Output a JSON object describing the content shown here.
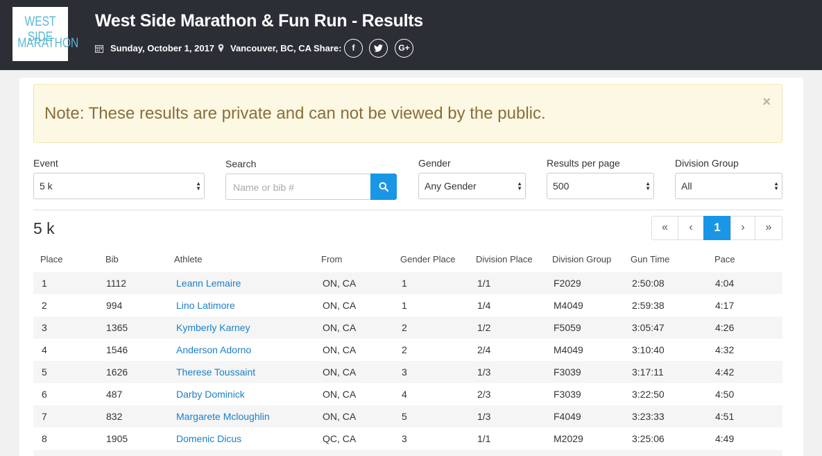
{
  "header": {
    "logo_line1": "WEST SIDE",
    "logo_line2": "MARATHON",
    "title": "West Side Marathon & Fun Run - Results",
    "date": "Sunday, October 1, 2017",
    "location": "Vancouver, BC, CA",
    "share_label": "Share:",
    "share_buttons": [
      {
        "icon": "facebook-icon",
        "glyph": "f"
      },
      {
        "icon": "twitter-icon",
        "glyph": "t"
      },
      {
        "icon": "google-plus-icon",
        "glyph": "G+"
      }
    ]
  },
  "alert": {
    "text": "Note: These results are private and can not be viewed by the public.",
    "close": "×"
  },
  "filters": {
    "event": {
      "label": "Event",
      "value": "5 k"
    },
    "search": {
      "label": "Search",
      "placeholder": "Name or bib #"
    },
    "gender": {
      "label": "Gender",
      "value": "Any Gender"
    },
    "per_page": {
      "label": "Results per page",
      "value": "500"
    },
    "division": {
      "label": "Division Group",
      "value": "All"
    }
  },
  "section_title": "5 k",
  "pagination": {
    "first": "«",
    "prev": "‹",
    "current": "1",
    "next": "›",
    "last": "»"
  },
  "table": {
    "headers": [
      "Place",
      "Bib",
      "Athlete",
      "From",
      "Gender Place",
      "Division Place",
      "Division Group",
      "Gun Time",
      "Pace"
    ],
    "rows": [
      [
        "1",
        "1112",
        "Leann Lemaire",
        "ON, CA",
        "1",
        "1/1",
        "F2029",
        "2:50:08",
        "4:04"
      ],
      [
        "2",
        "994",
        "Lino Latimore",
        "ON, CA",
        "1",
        "1/4",
        "M4049",
        "2:59:38",
        "4:17"
      ],
      [
        "3",
        "1365",
        "Kymberly Karney",
        "ON, CA",
        "2",
        "1/2",
        "F5059",
        "3:05:47",
        "4:26"
      ],
      [
        "4",
        "1546",
        "Anderson Adorno",
        "ON, CA",
        "2",
        "2/4",
        "M4049",
        "3:10:40",
        "4:32"
      ],
      [
        "5",
        "1626",
        "Therese Toussaint",
        "ON, CA",
        "3",
        "1/3",
        "F3039",
        "3:17:11",
        "4:42"
      ],
      [
        "6",
        "487",
        "Darby Dominick",
        "ON, CA",
        "4",
        "2/3",
        "F3039",
        "3:22:50",
        "4:50"
      ],
      [
        "7",
        "832",
        "Margarete Mcloughlin",
        "ON, CA",
        "5",
        "1/3",
        "F4049",
        "3:23:33",
        "4:51"
      ],
      [
        "8",
        "1905",
        "Domenic Dicus",
        "QC, CA",
        "3",
        "1/1",
        "M2029",
        "3:25:06",
        "4:49"
      ]
    ]
  },
  "colors": {
    "accent": "#1996e6",
    "link": "#1a7fc9",
    "topbar": "#2b2e35",
    "alert_bg": "#fcf8e3",
    "alert_text": "#8a6d3b"
  }
}
